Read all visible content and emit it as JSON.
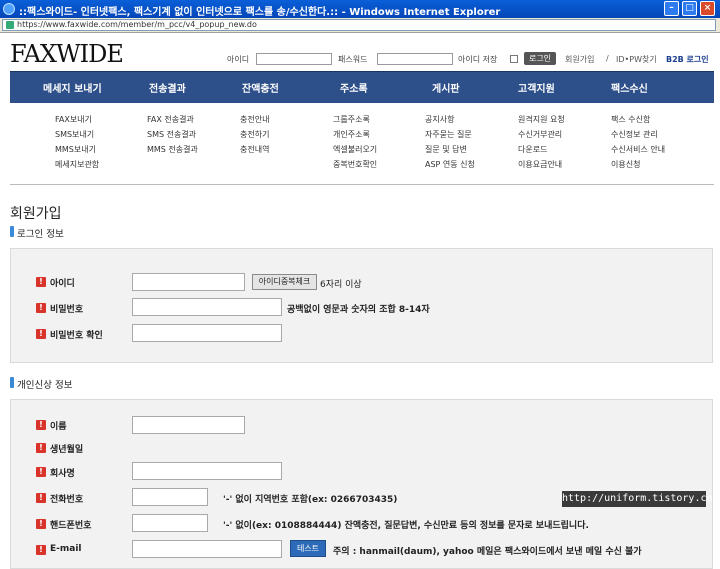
{
  "window": {
    "title": "::팩스와이드- 인터넷팩스, 팩스기계 없이 인터넷으로 팩스를 송/수신한다.:: - Windows Internet Explorer",
    "url": "https://www.faxwide.com/member/m_pcc/v4_popup_new.do"
  },
  "header": {
    "logo": "FAXWIDE",
    "id_label": "아이디",
    "pw_label": "패스워드",
    "save_id_label": "아이디 저장",
    "login_button": "로그인",
    "signup_link": "회원가입",
    "separator": "/",
    "find_link": "ID•PW찾기",
    "b2b_link": "B2B 로그인"
  },
  "nav": {
    "tabs": [
      "메세지 보내기",
      "전송결과",
      "잔액충전",
      "주소록",
      "게시판",
      "고객지원",
      "팩스수신"
    ],
    "columns": [
      [
        "FAX보내기",
        "SMS보내기",
        "MMS보내기",
        "메세지보관함"
      ],
      [
        "FAX 전송결과",
        "SMS 전송결과",
        "MMS 전송결과"
      ],
      [
        "충전안내",
        "충전하기",
        "충전내역"
      ],
      [
        "그룹주소록",
        "개인주소록",
        "엑셀불러오기",
        "중복번호확인"
      ],
      [
        "공지사항",
        "자주묻는 질문",
        "질문 및 답변",
        "ASP 연동 신청"
      ],
      [
        "원격지원 요청",
        "수신거부관리",
        "다운로드",
        "이용요금안내"
      ],
      [
        "팩스 수신함",
        "수신정보 관리",
        "수신서비스 안내",
        "이용신청"
      ]
    ]
  },
  "page": {
    "title": "회원가입",
    "login_section": {
      "title": "로그인 정보",
      "id_label": "아이디",
      "dup_check_button": "아이디중복체크",
      "id_hint": "6자리 이상",
      "pw_label": "비밀번호",
      "pw_hint": "공백없이 영문과 숫자의 조합 8-14자",
      "pw_confirm_label": "비밀번호 확인"
    },
    "personal_section": {
      "title": "개인신상 정보",
      "name_label": "이름",
      "birth_label": "생년월일",
      "company_label": "회사명",
      "phone_label": "전화번호",
      "phone_hint": "'-' 없이 지역번호 포함(ex: 0266703435)",
      "mobile_label": "핸드폰번호",
      "mobile_hint": "'-' 없이(ex: 0108884444) 잔액충전, 질문답변, 수신만료 등의 정보를 문자로 보내드립니다.",
      "email_label": "E-mail",
      "test_button": "테스트",
      "email_hint": "주의 : hanmail(daum), yahoo 메일은 팩스와이드에서 보낸 메일 수신 불가"
    },
    "required_mark": "!"
  },
  "watermark": "http://uniform.tistory.com",
  "colors": {
    "nav": "#2d4f8a",
    "required": "#d9342b",
    "button_blue": "#2d6bb8",
    "panel": "#f2f2f2"
  }
}
